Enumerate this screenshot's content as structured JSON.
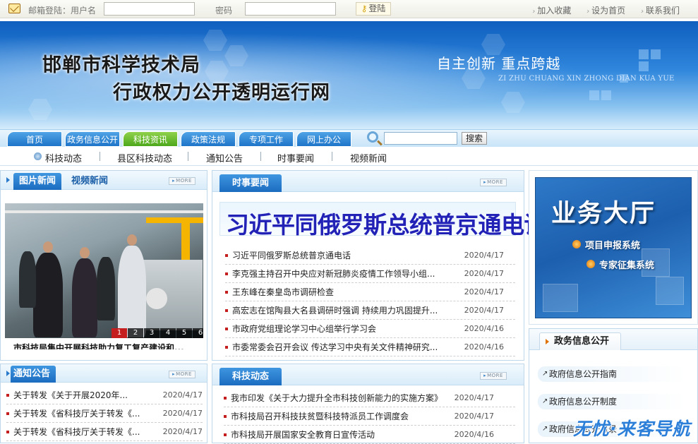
{
  "topbar": {
    "mail_label": "邮箱登陆：用户名",
    "password_label": "密码",
    "username_value": "",
    "password_value": "",
    "login_button": "登陆",
    "links": [
      "加入收藏",
      "设为首页",
      "联系我们"
    ]
  },
  "banner": {
    "title_line1": "邯郸市科学技术局",
    "title_line2": "行政权力公开透明运行网",
    "slogan": "自主创新  重点跨越",
    "slogan_pinyin": "ZI ZHU CHUANG XIN ZHONG DIAN KUA YUE"
  },
  "nav": {
    "tabs": [
      "首页",
      "政务信息公开",
      "科技资讯",
      "政策法规",
      "专项工作",
      "网上办公"
    ],
    "active_tab": "科技资讯",
    "search_value": "",
    "search_button": "搜索"
  },
  "subnav": {
    "items": [
      "科技动态",
      "县区科技动态",
      "通知公告",
      "时事要闻",
      "视频新闻"
    ]
  },
  "photo_news": {
    "tab1": "图片新闻",
    "tab2": "视频新闻",
    "more": "MORE",
    "pages": [
      "1",
      "2",
      "3",
      "4",
      "5",
      "6"
    ],
    "active_page": "1",
    "caption": "市科技局集中开展科技助力复工复产建设和..."
  },
  "current_news": {
    "title": "时事要闻",
    "more": "MORE",
    "headline": "习近平同俄罗斯总统普京通电话",
    "items": [
      {
        "title": "习近平同俄罗斯总统普京通电话",
        "date": "2020/4/17"
      },
      {
        "title": "李克强主持召开中央应对新冠肺炎疫情工作领导小组...",
        "date": "2020/4/17"
      },
      {
        "title": "王东峰在秦皇岛市调研检查",
        "date": "2020/4/17"
      },
      {
        "title": "高宏志在馆陶县大名县调研时强调  持续用力巩固提升...",
        "date": "2020/4/17"
      },
      {
        "title": "市政府党组理论学习中心组举行学习会",
        "date": "2020/4/16"
      },
      {
        "title": "市委常委会召开会议  传达学习中央有关文件精神研究...",
        "date": "2020/4/16"
      }
    ]
  },
  "hall": {
    "title": "业务大厅",
    "link1": "项目申报系统",
    "link2": "专家征集系统"
  },
  "gov_info": {
    "title": "政务信息公开",
    "items": [
      "政府信息公开指南",
      "政府信息公开制度",
      "政府信息公开目录"
    ]
  },
  "notice": {
    "title": "通知公告",
    "more": "MORE",
    "items": [
      {
        "title": "关于转发《关于开展2020年...",
        "date": "2020/4/17"
      },
      {
        "title": "关于转发《省科技厅关于转发《...",
        "date": "2020/4/17"
      },
      {
        "title": "关于转发《省科技厅关于转发《...",
        "date": "2020/4/17"
      }
    ]
  },
  "tech_news": {
    "title": "科技动态",
    "more": "MORE",
    "items": [
      {
        "title": "我市印发《关于大力提升全市科技创新能力的实施方案》",
        "date": "2020/4/17"
      },
      {
        "title": "市科技局召开科技扶贫暨科技特派员工作调度会",
        "date": "2020/4/17"
      },
      {
        "title": "市科技局开展国家安全教育日宣传活动",
        "date": "2020/4/16"
      }
    ]
  },
  "watermark": "无忧·来客导航",
  "colors": {
    "primary_blue": "#1e74c8",
    "active_green": "#4da81b",
    "bullet_red": "#c41e1e"
  }
}
